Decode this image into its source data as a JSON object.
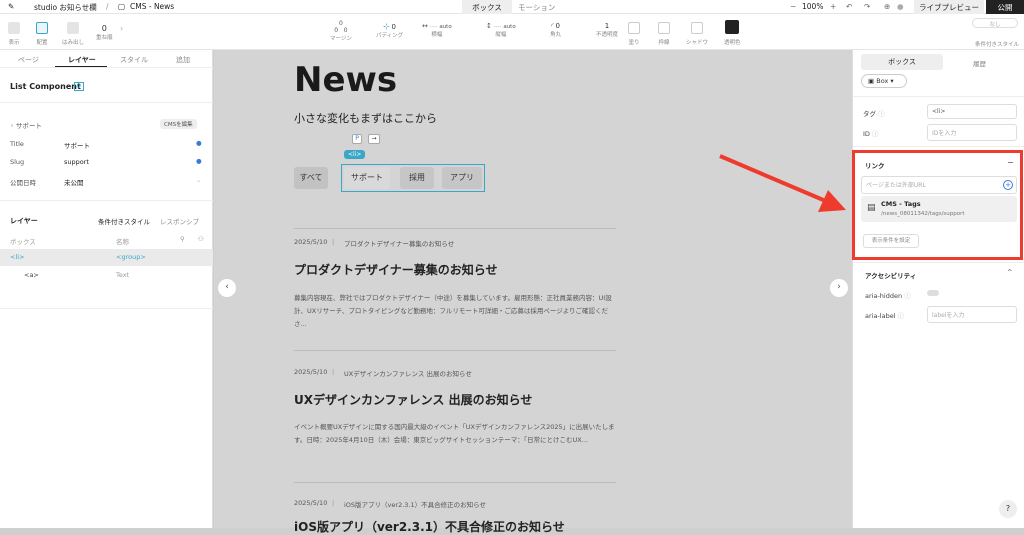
{
  "topbar": {
    "breadcrumb_site": "studio お知らせ欄",
    "breadcrumb_page": "CMS - News",
    "tab_box": "ボックス",
    "tab_motion": "モーション",
    "zoom": "100%",
    "preview": "ライブプレビュー",
    "publish": "公開"
  },
  "toolbar": {
    "display": "表示",
    "layout": "配置",
    "overflow": "はみ出し",
    "order_value": "0",
    "order": "重ね順",
    "margin": "マージン",
    "margin_val": "0",
    "padding": "パディング",
    "padding_val": "0",
    "width": "横幅",
    "width_val": "auto",
    "height": "縦幅",
    "height_val": "auto",
    "radius": "角丸",
    "radius_val": "0",
    "opacity": "不透明度",
    "opacity_val": "1",
    "fill": "塗り",
    "border": "枠線",
    "shadow": "シャドウ",
    "text_color": "透明色",
    "condition": "条件付きスタイル",
    "none": "なし"
  },
  "left": {
    "tabs": [
      "ページ",
      "レイヤー",
      "スタイル",
      "追加"
    ],
    "component_title": "List Component",
    "component_badge": "0",
    "section": "サポート",
    "cms_edit": "CMSを編集",
    "fields": [
      {
        "label": "Title",
        "value": "サポート"
      },
      {
        "label": "Slug",
        "value": "support"
      },
      {
        "label": "公開日時",
        "value": "未公開"
      }
    ],
    "layer_title": "レイヤー",
    "layer_tab_cond": "条件付きスタイル",
    "layer_tab_resp": "レスポンシブ",
    "col_box": "ボックス",
    "col_name": "名称",
    "layers": [
      {
        "box": "<li>",
        "name": "<group>"
      },
      {
        "box": "<a>",
        "name": "Text"
      }
    ]
  },
  "page": {
    "title": "News",
    "subtitle": "小さな変化もまずはここから",
    "li_badge": "<li>",
    "filters": [
      "すべて",
      "サポート",
      "採用",
      "アプリ"
    ],
    "articles": [
      {
        "date": "2025/5/10",
        "tag": "プロダクトデザイナー募集のお知らせ",
        "title": "プロダクトデザイナー募集のお知らせ",
        "body": "募集内容現在、弊社ではプロダクトデザイナー（中途）を募集しています。雇用形態：正社員業務内容：UI設計、UXリサーチ、プロトタイピングなど勤務地：フルリモート可詳細・ご応募は採用ページよりご確認くださ..."
      },
      {
        "date": "2025/5/10",
        "tag": "UXデザインカンファレンス 出展のお知らせ",
        "title": "UXデザインカンファレンス 出展のお知らせ",
        "body": "イベント概要UXデザインに関する国内最大級のイベント「UXデザインカンファレンス2025」に出展いたします。日時：2025年4月10日（木）会場：東京ビッグサイトセッションテーマ：「日常にとけこむUX..."
      },
      {
        "date": "2025/5/10",
        "tag": "iOS版アプリ（ver2.3.1）不具合修正のお知らせ",
        "title": "iOS版アプリ（ver2.3.1）不具合修正のお知らせ",
        "body": ""
      }
    ]
  },
  "right": {
    "tab_box": "ボックス",
    "tab_history": "履歴",
    "box_select": "Box",
    "tag_label": "タグ",
    "tag_value": "<li>",
    "id_label": "ID",
    "id_placeholder": "IDを入力",
    "link_title": "リンク",
    "link_placeholder": "ページまたは外部URL",
    "link_item_title": "CMS - Tags",
    "link_item_path": "/news_08011342/tags/support",
    "cond_button": "表示条件を設定",
    "a11y_title": "アクセシビリティ",
    "aria_hidden": "aria-hidden",
    "aria_label": "aria-label",
    "aria_label_placeholder": "labelを入力",
    "help": "?"
  },
  "colors": {
    "highlight": "#ef3b2d",
    "accent": "#3aa6c8",
    "arrow": "#ef3b2d"
  }
}
